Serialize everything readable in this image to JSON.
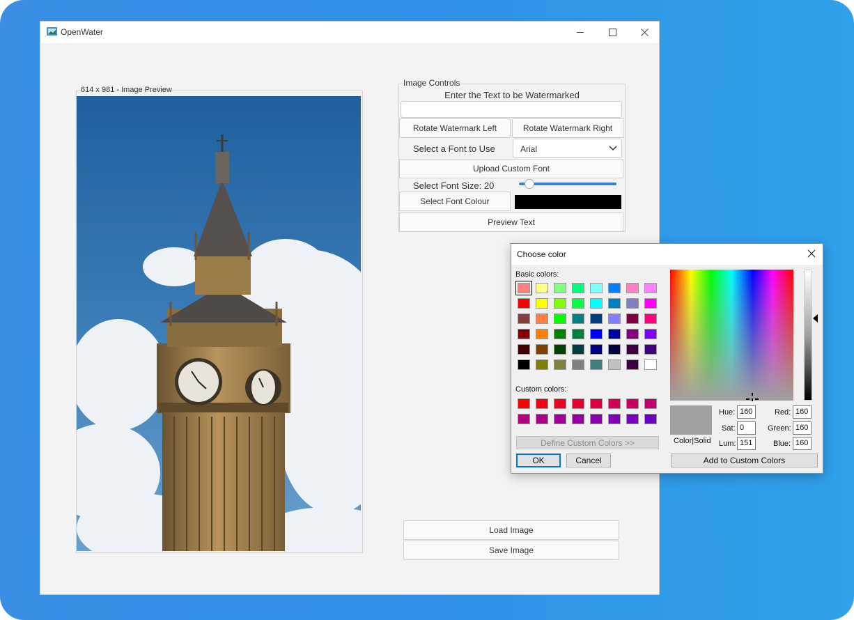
{
  "window": {
    "title": "OpenWater"
  },
  "preview": {
    "label": "614 x 981 - Image Preview"
  },
  "controls": {
    "legend": "Image Controls",
    "watermark_prompt": "Enter the Text to be Watermarked",
    "watermark_text": "",
    "rotate_left": "Rotate Watermark Left",
    "rotate_right": "Rotate Watermark Right",
    "font_label": "Select a Font to Use",
    "font_value": "Arial",
    "upload_font": "Upload Custom Font",
    "font_size_label": "Select Font Size: 20",
    "font_size": 20,
    "font_colour_button": "Select Font Colour",
    "font_colour": "#000000",
    "preview_text": "Preview Text"
  },
  "actions": {
    "load": "Load Image",
    "save": "Save Image"
  },
  "color_dialog": {
    "title": "Choose color",
    "basic_label": "Basic colors:",
    "custom_label": "Custom colors:",
    "basic_colors": [
      "#ff8080",
      "#ffff80",
      "#80ff80",
      "#00ff80",
      "#80ffff",
      "#0080ff",
      "#ff80c0",
      "#ff80ff",
      "#ff0000",
      "#ffff00",
      "#80ff00",
      "#00ff40",
      "#00ffff",
      "#0080c0",
      "#8080c0",
      "#ff00ff",
      "#804040",
      "#ff8040",
      "#00ff00",
      "#008080",
      "#004080",
      "#8080ff",
      "#800040",
      "#ff0080",
      "#800000",
      "#ff8000",
      "#008000",
      "#008040",
      "#0000ff",
      "#0000a0",
      "#800080",
      "#8000ff",
      "#400000",
      "#804000",
      "#004000",
      "#004040",
      "#000080",
      "#000040",
      "#400040",
      "#400080",
      "#000000",
      "#808000",
      "#808040",
      "#808080",
      "#408080",
      "#c0c0c0",
      "#400040",
      "#ffffff"
    ],
    "custom_colors": [
      "#ff0000",
      "#f00010",
      "#ee0020",
      "#e60030",
      "#dc0040",
      "#d20050",
      "#c80060",
      "#be0070",
      "#b4007e",
      "#aa008a",
      "#a00096",
      "#9600a0",
      "#8c00aa",
      "#8200b4",
      "#7800bc",
      "#6e00c4"
    ],
    "define_custom": "Define Custom Colors >>",
    "ok": "OK",
    "cancel": "Cancel",
    "color_solid": "Color|Solid",
    "hue_label": "Hue:",
    "hue": "160",
    "sat_label": "Sat:",
    "sat": "0",
    "lum_label": "Lum:",
    "lum": "151",
    "red_label": "Red:",
    "red": "160",
    "green_label": "Green:",
    "green": "160",
    "blue_label": "Blue:",
    "blue": "160",
    "add_custom": "Add to Custom Colors"
  }
}
